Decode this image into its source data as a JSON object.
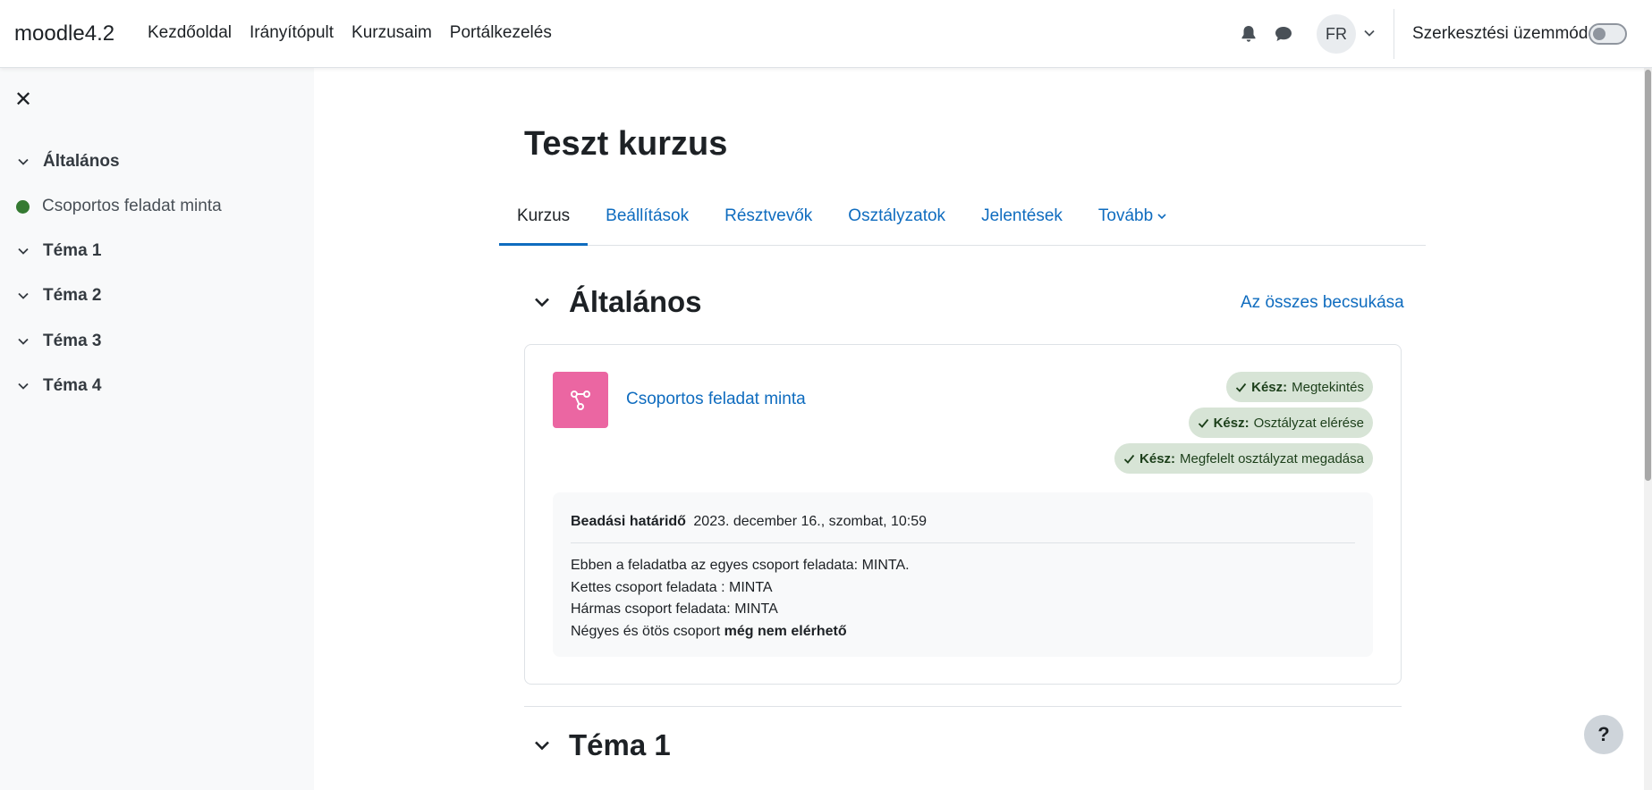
{
  "navbar": {
    "brand": "moodle4.2",
    "links": [
      "Kezdőoldal",
      "Irányítópult",
      "Kurzusaim",
      "Portálkezelés"
    ],
    "user_initials": "FR",
    "edit_mode_label": "Szerkesztési üzemmód",
    "edit_mode_on": false,
    "icons": [
      "bell-icon",
      "chat-icon",
      "chevron-down-icon"
    ]
  },
  "drawer": {
    "close_icon": "close-icon",
    "items": [
      {
        "type": "section",
        "label": "Általános"
      },
      {
        "type": "activity",
        "label": "Csoportos feladat minta",
        "status_color": "#357a32"
      },
      {
        "type": "section",
        "label": "Téma 1"
      },
      {
        "type": "section",
        "label": "Téma 2"
      },
      {
        "type": "section",
        "label": "Téma 3"
      },
      {
        "type": "section",
        "label": "Téma 4"
      }
    ]
  },
  "course": {
    "title": "Teszt kurzus",
    "tabs": [
      "Kurzus",
      "Beállítások",
      "Résztvevők",
      "Osztályzatok",
      "Jelentések",
      "Tovább"
    ],
    "active_tab": "Kurzus"
  },
  "sections": [
    {
      "title": "Általános",
      "collapse_all": "Az összes becsukása",
      "activity": {
        "icon": "assignment-icon",
        "icon_color": "#eb66a2",
        "name": "Csoportos feladat minta",
        "badges": [
          {
            "prefix": "Kész:",
            "text": "Megtekintés"
          },
          {
            "prefix": "Kész:",
            "text": "Osztályzat elérése"
          },
          {
            "prefix": "Kész:",
            "text": "Megfelelt osztályzat megadása"
          }
        ],
        "due_label": "Beadási határidő",
        "due_value": "2023. december 16., szombat, 10:59",
        "description": [
          "Ebben a feladatba az egyes csoport feladata: MINTA.",
          "Kettes csoport feladata : MINTA",
          "Hármas csoport feladata: MINTA"
        ],
        "description_last_prefix": "Négyes és ötös csoport",
        "description_last_bold": "még nem elérhető"
      }
    },
    {
      "title": "Téma 1"
    }
  ],
  "help_label": "?",
  "colors": {
    "link": "#0f6cbf",
    "badge_bg": "#d7e4d6",
    "drawer_bg": "#f8f9fa"
  }
}
